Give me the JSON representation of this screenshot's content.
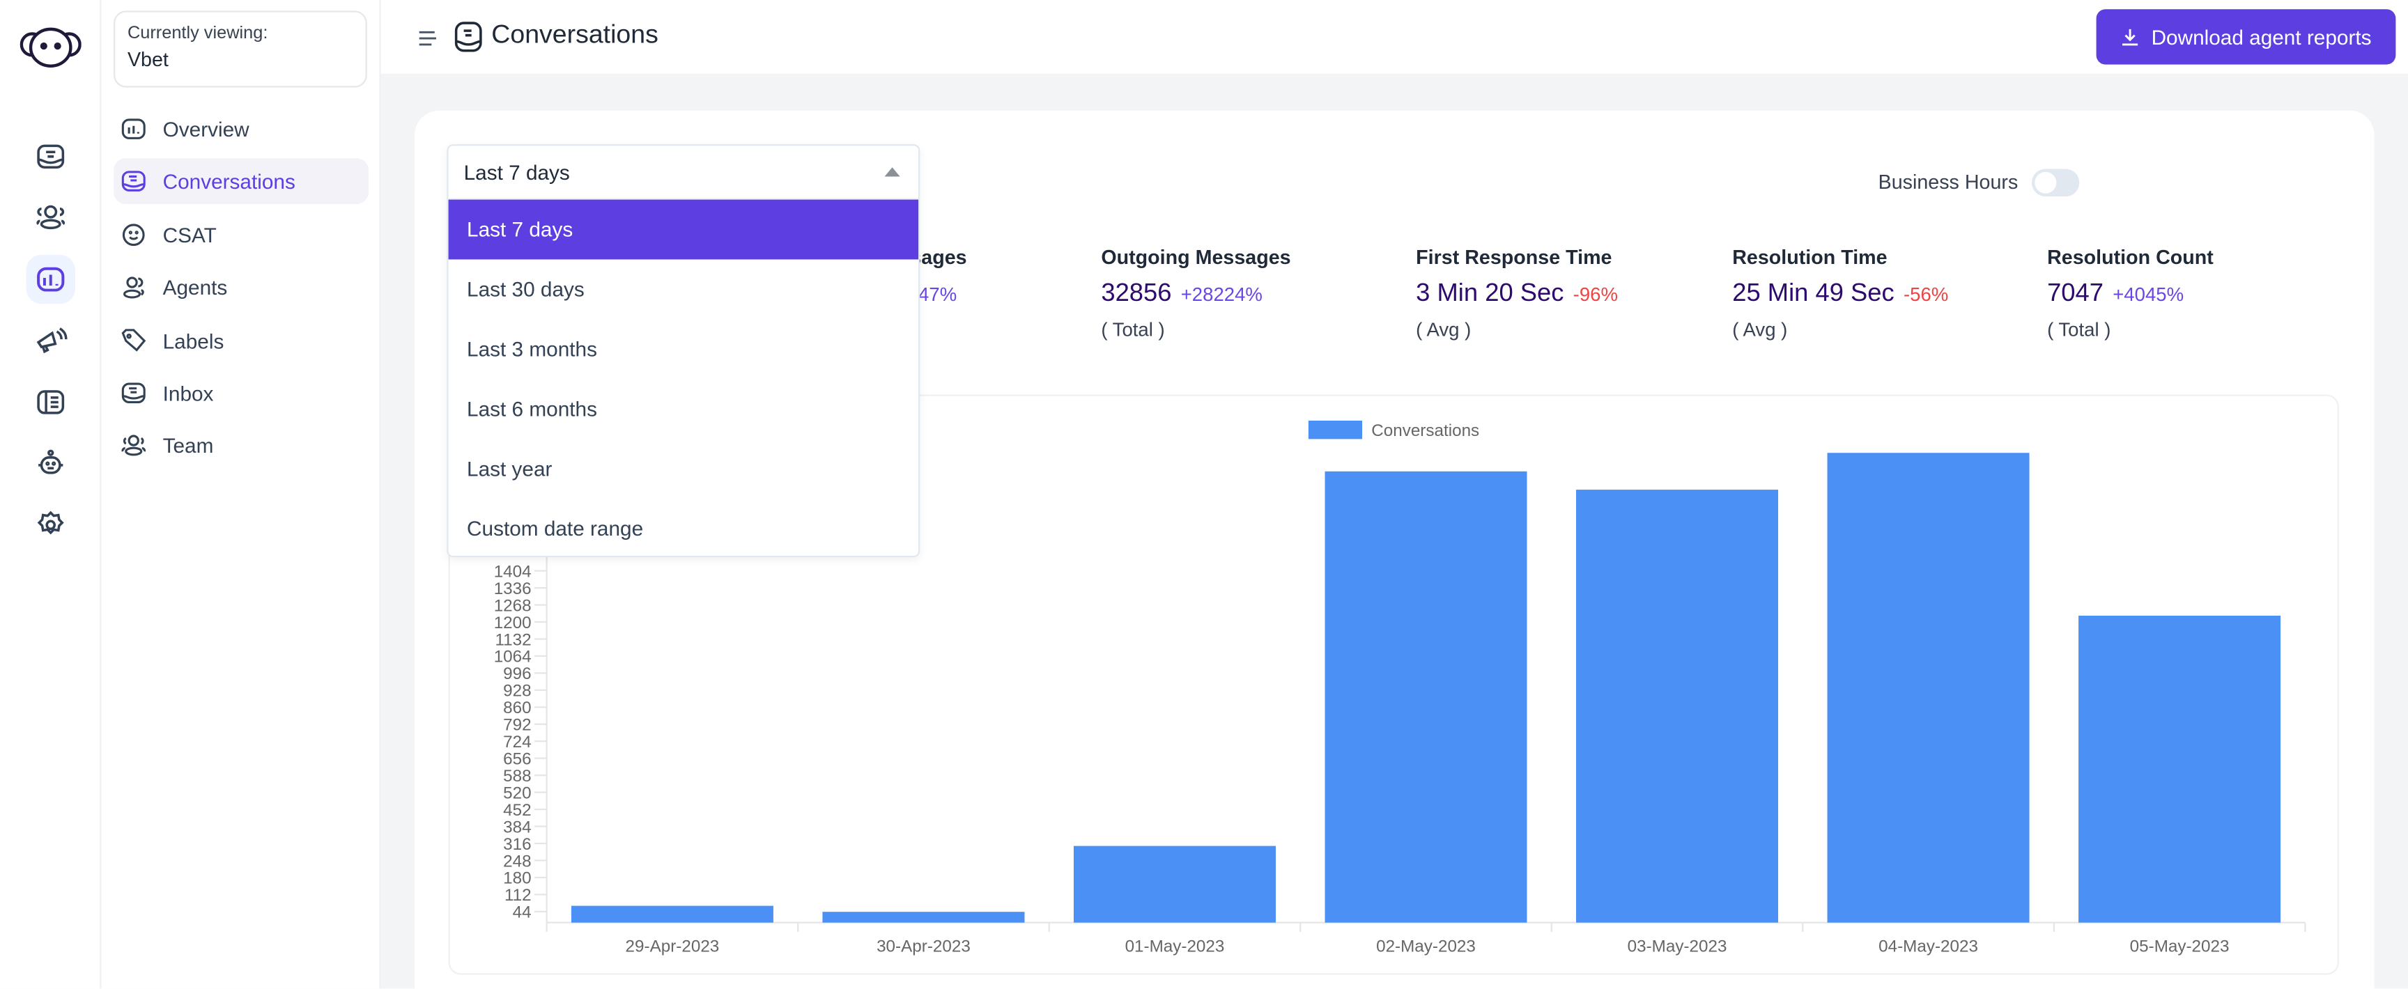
{
  "sidebar": {
    "viewing_label": "Currently viewing:",
    "account": "Vbet",
    "items": [
      {
        "label": "Overview",
        "icon": "chart-icon"
      },
      {
        "label": "Conversations",
        "icon": "conversation-icon",
        "active": true
      },
      {
        "label": "CSAT",
        "icon": "smile-icon"
      },
      {
        "label": "Agents",
        "icon": "agents-icon"
      },
      {
        "label": "Labels",
        "icon": "tag-icon"
      },
      {
        "label": "Inbox",
        "icon": "inbox-icon"
      },
      {
        "label": "Team",
        "icon": "team-icon"
      }
    ]
  },
  "rail": {
    "icons": [
      "conversations-icon",
      "contacts-icon",
      "reports-icon",
      "campaigns-icon",
      "help-center-icon",
      "bot-icon",
      "settings-icon"
    ],
    "active": "reports-icon"
  },
  "header": {
    "title": "Conversations",
    "download_label": "Download agent reports"
  },
  "filters": {
    "date_range": "Last 7 days",
    "options": [
      "Last 7 days",
      "Last 30 days",
      "Last 3 months",
      "Last 6 months",
      "Last year",
      "Custom date range"
    ],
    "business_hours_label": "Business Hours",
    "business_hours_on": false
  },
  "metrics": [
    {
      "title": "Incoming Messages",
      "value": "",
      "change": "47%",
      "change_type": "pos",
      "sub": ""
    },
    {
      "title": "Outgoing Messages",
      "value": "32856",
      "change": "+28224%",
      "change_type": "pos",
      "sub": "( Total )"
    },
    {
      "title": "First Response Time",
      "value": "3 Min 20 Sec",
      "change": "-96%",
      "change_type": "neg",
      "sub": "( Avg )"
    },
    {
      "title": "Resolution Time",
      "value": "25 Min 49 Sec",
      "change": "-56%",
      "change_type": "neg",
      "sub": "( Avg )"
    },
    {
      "title": "Resolution Count",
      "value": "7047",
      "change": "+4045%",
      "change_type": "pos",
      "sub": "( Total )"
    }
  ],
  "colors": {
    "accent": "#5d3ee0",
    "bar": "#4a90f5",
    "negative": "#ef4444",
    "value": "#2d0a6e"
  },
  "chart_data": {
    "type": "bar",
    "legend": [
      "Conversations"
    ],
    "legend_placement": "top",
    "categories": [
      "29-Apr-2023",
      "30-Apr-2023",
      "01-May-2023",
      "02-May-2023",
      "03-May-2023",
      "04-May-2023",
      "05-May-2023"
    ],
    "series": [
      {
        "name": "Conversations",
        "values": [
          67,
          43,
          306,
          1801,
          1728,
          1875,
          1225
        ]
      }
    ],
    "yticks": [
      44,
      112,
      180,
      248,
      316,
      384,
      452,
      520,
      588,
      656,
      724,
      792,
      860,
      928,
      996,
      1064,
      1132,
      1200,
      1268,
      1336,
      1404
    ],
    "ylim": [
      0,
      1904
    ],
    "grid": false
  }
}
